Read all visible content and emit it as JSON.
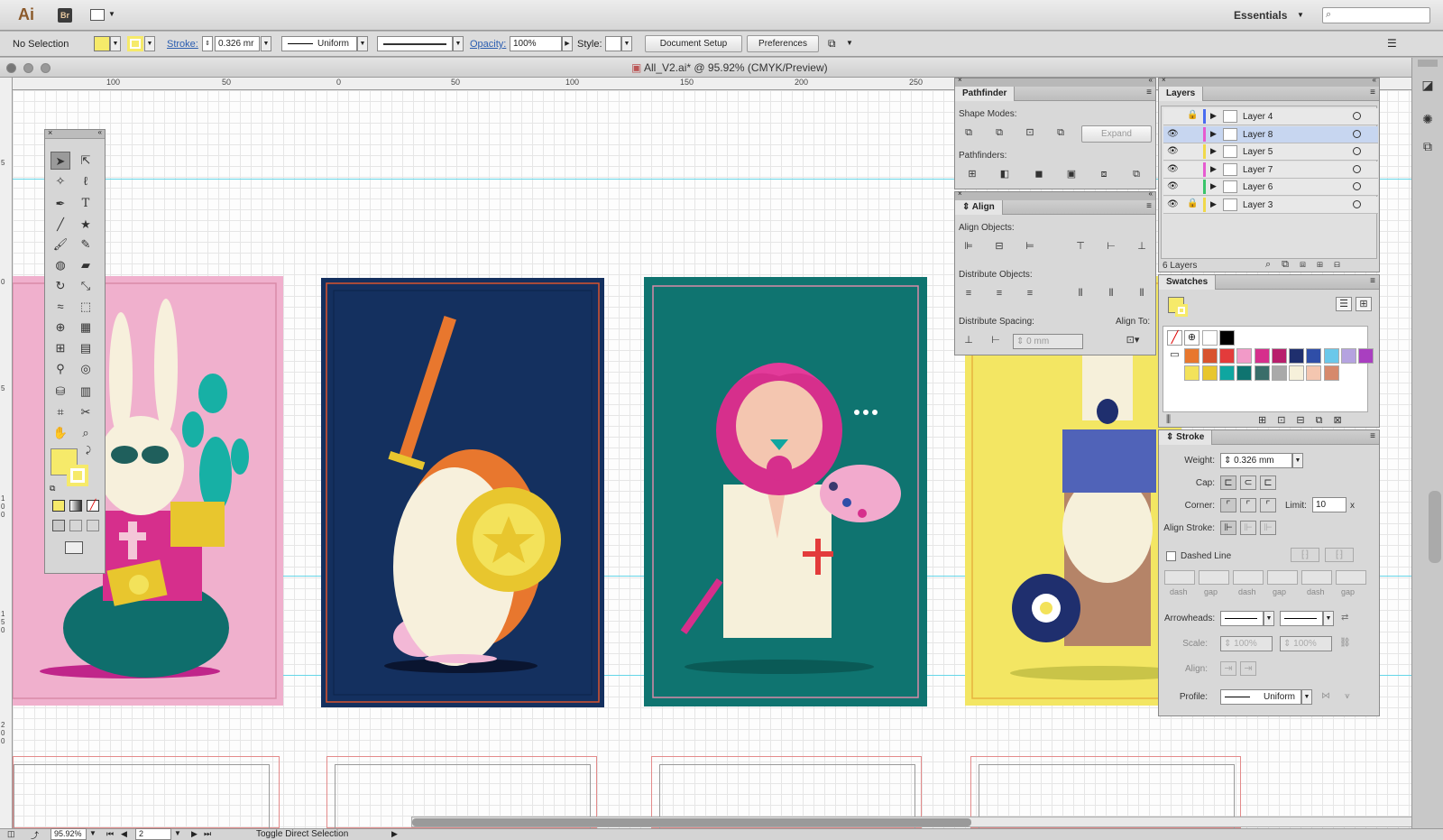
{
  "app": {
    "logo": "Ai",
    "bridge": "Br",
    "workspace": "Essentials",
    "search_placeholder": ""
  },
  "control": {
    "selection": "No Selection",
    "stroke_label": "Stroke:",
    "stroke_value": "0.326 mr",
    "profile": "Uniform",
    "opacity_label": "Opacity:",
    "opacity_value": "100%",
    "style_label": "Style:",
    "document_setup": "Document Setup",
    "preferences": "Preferences"
  },
  "document": {
    "title": "All_V2.ai* @ 95.92% (CMYK/Preview)"
  },
  "ruler": {
    "h": [
      "100",
      "50",
      "0",
      "50",
      "100",
      "150",
      "200",
      "250"
    ],
    "v": [
      "5",
      "0",
      "5",
      "1 0 0",
      "1 5 0",
      "2 0 0"
    ]
  },
  "pathfinder": {
    "tab": "Pathfinder",
    "shape_modes": "Shape Modes:",
    "expand": "Expand",
    "pathfinders": "Pathfinders:"
  },
  "align": {
    "tab": "Align",
    "align_objects": "Align Objects:",
    "distribute_objects": "Distribute Objects:",
    "distribute_spacing": "Distribute Spacing:",
    "align_to": "Align To:",
    "spacing_value": "0 mm"
  },
  "layers": {
    "tab": "Layers",
    "count": "6 Layers",
    "items": [
      {
        "name": "Layer 4",
        "color": "#4a6cf0",
        "visible": false,
        "locked": true
      },
      {
        "name": "Layer 8",
        "color": "#e65bd0",
        "visible": true,
        "locked": false
      },
      {
        "name": "Layer 5",
        "color": "#f0d84a",
        "visible": true,
        "locked": false
      },
      {
        "name": "Layer 7",
        "color": "#e65bd0",
        "visible": true,
        "locked": false
      },
      {
        "name": "Layer 6",
        "color": "#3ac46a",
        "visible": true,
        "locked": false
      },
      {
        "name": "Layer 3",
        "color": "#f0d84a",
        "visible": true,
        "locked": true
      }
    ]
  },
  "swatches": {
    "tab": "Swatches",
    "colors": [
      "#ffffff",
      "#000000",
      "#e8772e",
      "#d8532e",
      "#e33b3b",
      "#f29ac8",
      "#d62f8c",
      "#b81f6c",
      "#1f2f6e",
      "#2f4ea8",
      "#6ac8ea",
      "#b5a3e0",
      "#a93fc0",
      "#f3e25a",
      "#e8c62e",
      "#0fa6a0",
      "#0f7470",
      "#3a6e6a",
      "#a9a9a9",
      "#f6f0da",
      "#f4c6b0",
      "#d6896c"
    ]
  },
  "stroke": {
    "tab": "Stroke",
    "weight_label": "Weight:",
    "weight": "0.326 mm",
    "cap_label": "Cap:",
    "corner_label": "Corner:",
    "limit_label": "Limit:",
    "limit": "10",
    "limit_unit": "x",
    "align_label": "Align Stroke:",
    "dashed": "Dashed Line",
    "dash": [
      "dash",
      "gap",
      "dash",
      "gap",
      "dash",
      "gap"
    ],
    "arrowheads": "Arrowheads:",
    "scale": "Scale:",
    "scale1": "100%",
    "scale2": "100%",
    "align2": "Align:",
    "profile_label": "Profile:",
    "profile": "Uniform"
  },
  "status": {
    "zoom": "95.92%",
    "page": "2",
    "hint": "Toggle Direct Selection"
  }
}
